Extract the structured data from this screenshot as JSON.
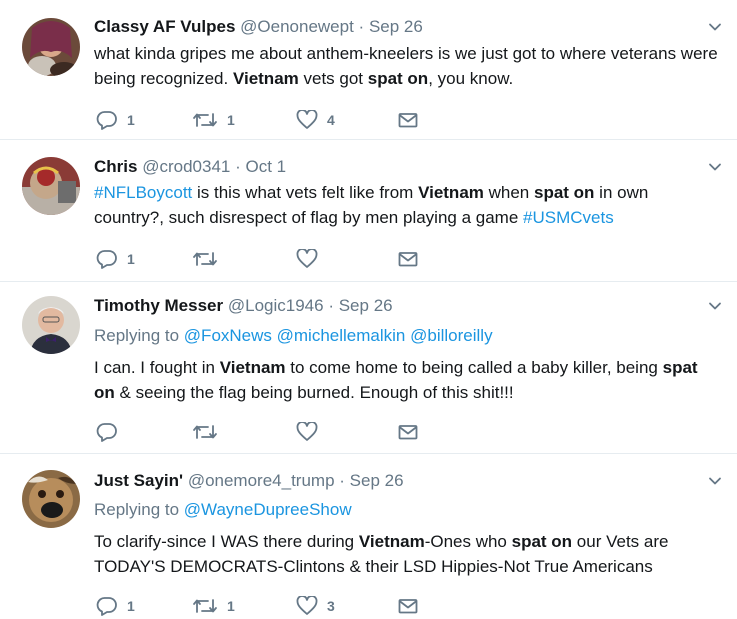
{
  "tweets": [
    {
      "name": "Classy AF Vulpes",
      "handle": "@Oenonewept",
      "dot": "·",
      "date": "Sep 26",
      "text": [
        {
          "t": "what kinda gripes me about anthem-kneelers is we just got to  where veterans were being recognized. "
        },
        {
          "t": "Vietnam",
          "b": true
        },
        {
          "t": " vets got "
        },
        {
          "t": "spat on",
          "b": true
        },
        {
          "t": ", you know."
        }
      ],
      "replies": "1",
      "retweets": "1",
      "likes": "4"
    },
    {
      "name": "Chris",
      "handle": "@crod0341",
      "dot": "·",
      "date": "Oct 1",
      "text": [
        {
          "t": "#NFLBoycott",
          "h": true
        },
        {
          "t": " is this what vets felt like from "
        },
        {
          "t": "Vietnam",
          "b": true
        },
        {
          "t": " when "
        },
        {
          "t": "spat on",
          "b": true
        },
        {
          "t": " in own country?, such disrespect of flag by men playing a game "
        },
        {
          "t": "#USMCvets",
          "h": true
        }
      ],
      "replies": "1",
      "retweets": "",
      "likes": ""
    },
    {
      "name": "Timothy Messer",
      "handle": "@Logic1946",
      "dot": "·",
      "date": "Sep 26",
      "replying_to_label": "Replying to",
      "replying_to": [
        "@FoxNews",
        "@michellemalkin",
        "@billoreilly"
      ],
      "text": [
        {
          "t": "I can. I fought in "
        },
        {
          "t": "Vietnam",
          "b": true
        },
        {
          "t": " to come home to being called a baby killer, being "
        },
        {
          "t": "spat on",
          "b": true
        },
        {
          "t": " & seeing the flag being burned. Enough of this shit!!!"
        }
      ],
      "replies": "",
      "retweets": "",
      "likes": ""
    },
    {
      "name": "Just Sayin'",
      "handle": "@onemore4_trump",
      "dot": "·",
      "date": "Sep 26",
      "replying_to_label": "Replying to",
      "replying_to": [
        "@WayneDupreeShow"
      ],
      "text": [
        {
          "t": "To clarify-since I WAS there during "
        },
        {
          "t": "Vietnam",
          "b": true
        },
        {
          "t": "-Ones who "
        },
        {
          "t": "spat on",
          "b": true
        },
        {
          "t": " our Vets are TODAY'S DEMOCRATS-Clintons & their LSD Hippies-Not True Americans"
        }
      ],
      "replies": "1",
      "retweets": "1",
      "likes": "3"
    }
  ],
  "icons": {
    "reply": "reply-icon",
    "retweet": "retweet-icon",
    "like": "heart-icon",
    "dm": "envelope-icon",
    "caret": "chevron-down-icon"
  },
  "colors": {
    "text": "#14171a",
    "secondary": "#657786",
    "link": "#1b95e0",
    "divider": "#e6ecf0"
  }
}
